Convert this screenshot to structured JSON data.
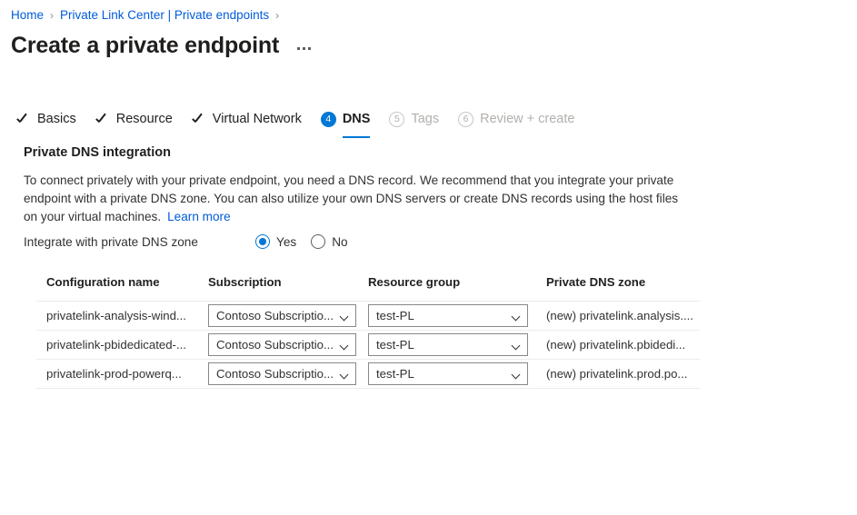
{
  "breadcrumb": {
    "items": [
      {
        "label": "Home"
      },
      {
        "label": "Private Link Center | Private endpoints"
      }
    ],
    "separator": "›"
  },
  "header": {
    "title": "Create a private endpoint",
    "more_menu": "..."
  },
  "wizard": {
    "tabs": [
      {
        "label": "Basics",
        "state": "done",
        "marker": "✓"
      },
      {
        "label": "Resource",
        "state": "done",
        "marker": "✓"
      },
      {
        "label": "Virtual Network",
        "state": "done",
        "marker": "✓"
      },
      {
        "label": "DNS",
        "state": "active",
        "marker": "4"
      },
      {
        "label": "Tags",
        "state": "disabled",
        "marker": "5"
      },
      {
        "label": "Review + create",
        "state": "disabled",
        "marker": "6"
      }
    ]
  },
  "section": {
    "heading": "Private DNS integration",
    "description": "To connect privately with your private endpoint, you need a DNS record. We recommend that you integrate your private endpoint with a private DNS zone. You can also utilize your own DNS servers or create DNS records using the host files on your virtual machines.",
    "learn_more": "Learn more"
  },
  "integrate_field": {
    "label": "Integrate with private DNS zone",
    "options": [
      {
        "label": "Yes",
        "selected": true
      },
      {
        "label": "No",
        "selected": false
      }
    ]
  },
  "table": {
    "columns": [
      {
        "header": "Configuration name"
      },
      {
        "header": "Subscription"
      },
      {
        "header": "Resource group"
      },
      {
        "header": "Private DNS zone"
      }
    ],
    "rows": [
      {
        "configuration_name": "privatelink-analysis-wind...",
        "subscription": "Contoso Subscriptio...",
        "resource_group": "test-PL",
        "private_dns_zone": "(new) privatelink.analysis...."
      },
      {
        "configuration_name": "privatelink-pbidedicated-...",
        "subscription": "Contoso Subscriptio...",
        "resource_group": "test-PL",
        "private_dns_zone": "(new) privatelink.pbidedi..."
      },
      {
        "configuration_name": "privatelink-prod-powerq...",
        "subscription": "Contoso Subscriptio...",
        "resource_group": "test-PL",
        "private_dns_zone": "(new) privatelink.prod.po..."
      }
    ]
  },
  "colors": {
    "accent": "#0078d4",
    "link": "#015cda",
    "text": "#323130",
    "disabled": "#b3b0ad",
    "border": "#8a8886",
    "row_divider": "#edebe9"
  }
}
